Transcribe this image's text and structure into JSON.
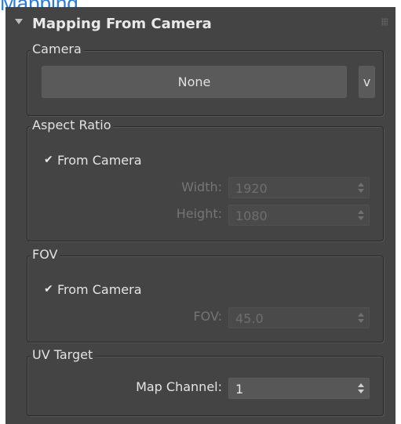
{
  "background_header_fragment": "Mapping",
  "rollout": {
    "title": "Mapping From Camera",
    "collapse_icon": "triangle-down-icon",
    "grip_icon": "grip-dots-icon"
  },
  "camera_group": {
    "title": "Camera",
    "select_button_label": "None",
    "dropdown_button_label": "v"
  },
  "aspect_group": {
    "title": "Aspect Ratio",
    "from_camera_label": "From Camera",
    "from_camera_checked": true,
    "width_label": "Width:",
    "width_value": "1920",
    "height_label": "Height:",
    "height_value": "1080"
  },
  "fov_group": {
    "title": "FOV",
    "from_camera_label": "From Camera",
    "from_camera_checked": true,
    "fov_label": "FOV:",
    "fov_value": "45.0"
  },
  "uv_group": {
    "title": "UV Target",
    "map_channel_label": "Map Channel:",
    "map_channel_value": "1"
  },
  "colors": {
    "panel_bg": "#444444",
    "accent_blue": "#2b7bd6",
    "disabled_text": "#757575"
  }
}
